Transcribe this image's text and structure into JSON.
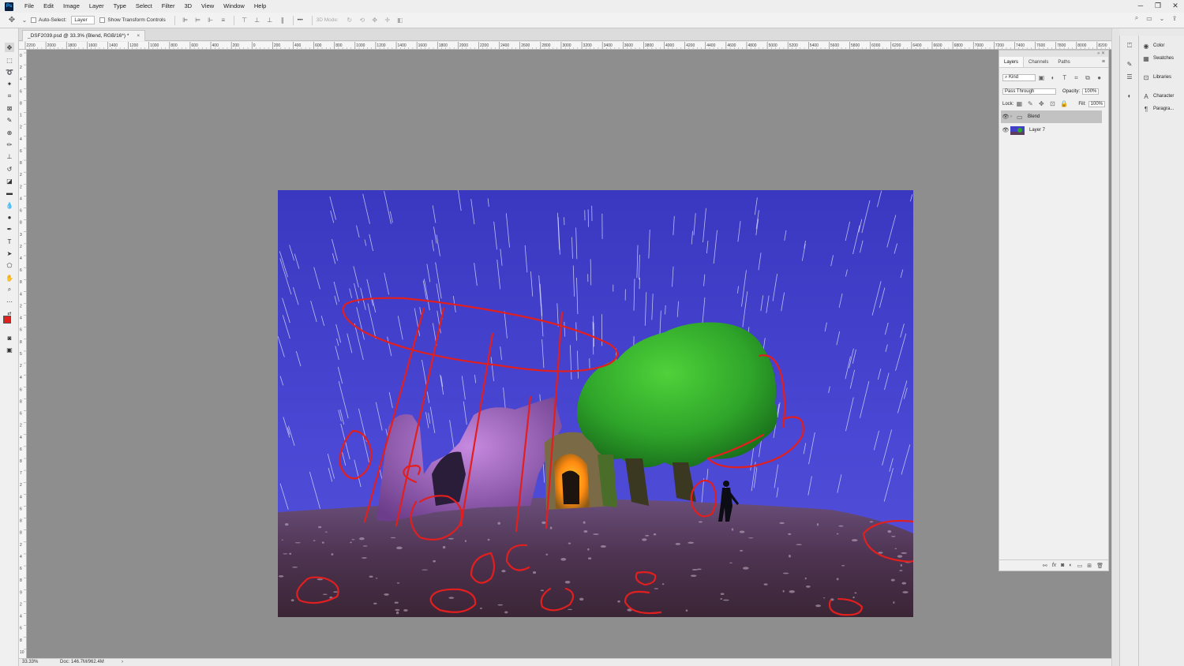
{
  "app": {
    "logo": "Ps"
  },
  "menu": [
    "File",
    "Edit",
    "Image",
    "Layer",
    "Type",
    "Select",
    "Filter",
    "3D",
    "View",
    "Window",
    "Help"
  ],
  "window_controls": {
    "minimize": "─",
    "restore": "❐",
    "close": "✕"
  },
  "options": {
    "auto_select_label": "Auto-Select:",
    "auto_select_value": "Layer",
    "transform_label": "Show Transform Controls",
    "more": "•••",
    "mode_3d": "3D Mode:"
  },
  "document": {
    "tab_title": "_DSF2039.psd @ 33.3% (Blend, RGB/16*) *",
    "close": "×"
  },
  "rulers": {
    "top_ticks": [
      "2200",
      "2000",
      "1800",
      "1600",
      "1400",
      "1200",
      "1000",
      "800",
      "600",
      "400",
      "200",
      "0",
      "200",
      "400",
      "600",
      "800",
      "1000",
      "1200",
      "1400",
      "1600",
      "1800",
      "2000",
      "2200",
      "2400",
      "2600",
      "2800",
      "3000",
      "3200",
      "3400",
      "3600",
      "3800",
      "4000",
      "4200",
      "4400",
      "4600",
      "4800",
      "5000",
      "5200",
      "5400",
      "5600",
      "5800",
      "6000",
      "6200",
      "6400",
      "6600",
      "6800",
      "7000",
      "7200",
      "7400",
      "7600",
      "7800",
      "8000",
      "8200"
    ],
    "left_ticks": [
      "0",
      "2",
      "4",
      "6",
      "8",
      "1",
      "2",
      "4",
      "6",
      "8",
      "2",
      "2",
      "4",
      "6",
      "8",
      "3",
      "2",
      "4",
      "6",
      "8",
      "4",
      "2",
      "4",
      "6",
      "8",
      "5",
      "2",
      "4",
      "6",
      "8",
      "6",
      "2",
      "4",
      "6",
      "8",
      "7",
      "2",
      "4",
      "6",
      "8",
      "8",
      "2",
      "4",
      "6",
      "8",
      "9",
      "2",
      "4",
      "6",
      "8",
      "10"
    ]
  },
  "status": {
    "zoom": "33.33%",
    "doc": "Doc: 146.7M/962.4M",
    "arrow": "›"
  },
  "layers_panel": {
    "tabs": [
      "Layers",
      "Channels",
      "Paths"
    ],
    "filter_kind": "Kind",
    "blend_mode": "Pass Through",
    "opacity_label": "Opacity:",
    "opacity_value": "100%",
    "lock_label": "Lock:",
    "fill_label": "Fill:",
    "fill_value": "100%",
    "layers": [
      {
        "name": "Blend",
        "type": "group",
        "selected": true
      },
      {
        "name": "Layer 7",
        "type": "image",
        "selected": false
      }
    ],
    "footer_icons": [
      "link-icon",
      "fx-icon",
      "mask-icon",
      "adjustment-icon",
      "folder-icon",
      "new-layer-icon",
      "trash-icon"
    ]
  },
  "dock": {
    "items": [
      {
        "label": "Color",
        "icon": "color-wheel-icon"
      },
      {
        "label": "Swatches",
        "icon": "swatches-grid-icon"
      },
      {
        "label": "Libraries",
        "icon": "libraries-icon"
      },
      {
        "label": "Character",
        "icon": "character-icon"
      },
      {
        "label": "Paragra...",
        "icon": "paragraph-icon"
      }
    ]
  },
  "colors": {
    "foreground": "#e0201b",
    "background": "#ffffff",
    "canvas_bg": "#8e8e8e",
    "sky": "#4340c8",
    "annotation": "#e21f1f"
  }
}
